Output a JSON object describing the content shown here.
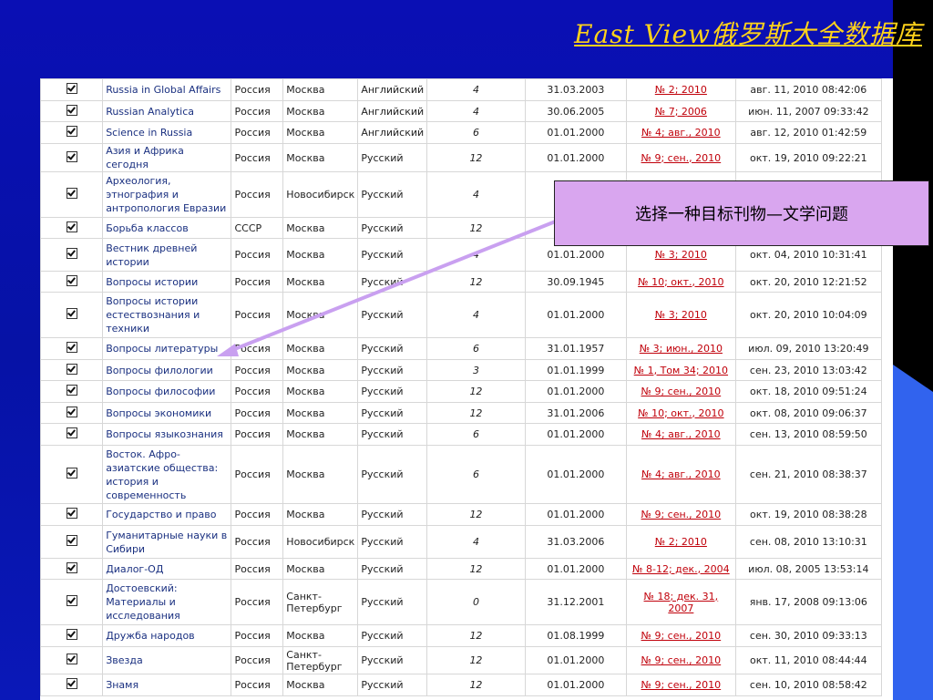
{
  "slide": {
    "title": "East View俄罗斯大全数据库",
    "callout": "选择一种目标刊物—文学问题"
  },
  "colors": {
    "background": "#0a0fb4",
    "title": "#ffd21a",
    "callout_fill": "#d9a6ef",
    "arrow": "#c9a0f0",
    "issue_link": "#c0000a",
    "accent_wedge": "#3163ee"
  },
  "rows": [
    {
      "title": "Russia in Global Affairs",
      "country": "Россия",
      "city": "Москва",
      "language": "Английский",
      "frequency": "4",
      "start": "31.03.2003",
      "issue": "№ 2; 2010",
      "updated": "авг. 11, 2010 08:42:06"
    },
    {
      "title": "Russian Analytica",
      "country": "Россия",
      "city": "Москва",
      "language": "Английский",
      "frequency": "4",
      "start": "30.06.2005",
      "issue": "№ 7; 2006",
      "updated": "июн. 11, 2007 09:33:42"
    },
    {
      "title": "Science in Russia",
      "country": "Россия",
      "city": "Москва",
      "language": "Английский",
      "frequency": "6",
      "start": "01.01.2000",
      "issue": "№ 4; авг., 2010",
      "updated": "авг. 12, 2010 01:42:59"
    },
    {
      "title": "Азия и Африка сегодня",
      "country": "Россия",
      "city": "Москва",
      "language": "Русский",
      "frequency": "12",
      "start": "01.01.2000",
      "issue": "№ 9; сен., 2010",
      "updated": "окт. 19, 2010 09:22:21"
    },
    {
      "title": "Археология, этнография и антропология Евразии",
      "country": "Россия",
      "city": "Новосибирск",
      "language": "Русский",
      "frequency": "4",
      "start": "31",
      "issue": "",
      "updated": ""
    },
    {
      "title": "Борьба классов",
      "country": "СССР",
      "city": "Москва",
      "language": "Русский",
      "frequency": "12",
      "start": "31",
      "issue": "",
      "updated": ""
    },
    {
      "title": "Вестник древней истории",
      "country": "Россия",
      "city": "Москва",
      "language": "Русский",
      "frequency": "4",
      "start": "01.01.2000",
      "issue": "№ 3; 2010",
      "updated": "окт. 04, 2010 10:31:41"
    },
    {
      "title": "Вопросы истории",
      "country": "Россия",
      "city": "Москва",
      "language": "Русский",
      "frequency": "12",
      "start": "30.09.1945",
      "issue": "№ 10; окт., 2010",
      "updated": "окт. 20, 2010 12:21:52"
    },
    {
      "title": "Вопросы истории естествознания и техники",
      "country": "Россия",
      "city": "Москва",
      "language": "Русский",
      "frequency": "4",
      "start": "01.01.2000",
      "issue": "№ 3; 2010",
      "updated": "окт. 20, 2010 10:04:09"
    },
    {
      "title": "Вопросы литературы",
      "country": "Россия",
      "city": "Москва",
      "language": "Русский",
      "frequency": "6",
      "start": "31.01.1957",
      "issue": "№ 3; июн., 2010",
      "updated": "июл. 09, 2010 13:20:49"
    },
    {
      "title": "Вопросы филологии",
      "country": "Россия",
      "city": "Москва",
      "language": "Русский",
      "frequency": "3",
      "start": "01.01.1999",
      "issue": "№ 1, Том 34; 2010",
      "updated": "сен. 23, 2010 13:03:42"
    },
    {
      "title": "Вопросы философии",
      "country": "Россия",
      "city": "Москва",
      "language": "Русский",
      "frequency": "12",
      "start": "01.01.2000",
      "issue": "№ 9; сен., 2010",
      "updated": "окт. 18, 2010 09:51:24"
    },
    {
      "title": "Вопросы экономики",
      "country": "Россия",
      "city": "Москва",
      "language": "Русский",
      "frequency": "12",
      "start": "31.01.2006",
      "issue": "№ 10; окт., 2010",
      "updated": "окт. 08, 2010 09:06:37"
    },
    {
      "title": "Вопросы языкознания",
      "country": "Россия",
      "city": "Москва",
      "language": "Русский",
      "frequency": "6",
      "start": "01.01.2000",
      "issue": "№ 4; авг., 2010",
      "updated": "сен. 13, 2010 08:59:50"
    },
    {
      "title": "Восток. Афро-азиатские общества: история и современность",
      "country": "Россия",
      "city": "Москва",
      "language": "Русский",
      "frequency": "6",
      "start": "01.01.2000",
      "issue": "№ 4; авг., 2010",
      "updated": "сен. 21, 2010 08:38:37"
    },
    {
      "title": "Государство и право",
      "country": "Россия",
      "city": "Москва",
      "language": "Русский",
      "frequency": "12",
      "start": "01.01.2000",
      "issue": "№ 9; сен., 2010",
      "updated": "окт. 19, 2010 08:38:28"
    },
    {
      "title": "Гуманитарные науки в Сибири",
      "country": "Россия",
      "city": "Новосибирск",
      "language": "Русский",
      "frequency": "4",
      "start": "31.03.2006",
      "issue": "№ 2; 2010",
      "updated": "сен. 08, 2010 13:10:31"
    },
    {
      "title": "Диалог-ОД",
      "country": "Россия",
      "city": "Москва",
      "language": "Русский",
      "frequency": "12",
      "start": "01.01.2000",
      "issue": "№ 8-12; дек., 2004",
      "updated": "июл. 08, 2005 13:53:14"
    },
    {
      "title": "Достоевский: Материалы и исследования",
      "country": "Россия",
      "city": "Санкт-Петербург",
      "language": "Русский",
      "frequency": "0",
      "start": "31.12.2001",
      "issue": "№ 18; дек. 31, 2007",
      "updated": "янв. 17, 2008 09:13:06"
    },
    {
      "title": "Дружба народов",
      "country": "Россия",
      "city": "Москва",
      "language": "Русский",
      "frequency": "12",
      "start": "01.08.1999",
      "issue": "№ 9; сен., 2010",
      "updated": "сен. 30, 2010 09:33:13"
    },
    {
      "title": "Звезда",
      "country": "Россия",
      "city": "Санкт-Петербург",
      "language": "Русский",
      "frequency": "12",
      "start": "01.01.2000",
      "issue": "№ 9; сен., 2010",
      "updated": "окт. 11, 2010 08:44:44"
    },
    {
      "title": "Знамя",
      "country": "Россия",
      "city": "Москва",
      "language": "Русский",
      "frequency": "12",
      "start": "01.01.2000",
      "issue": "№ 9; сен., 2010",
      "updated": "сен. 10, 2010 08:58:42"
    }
  ]
}
